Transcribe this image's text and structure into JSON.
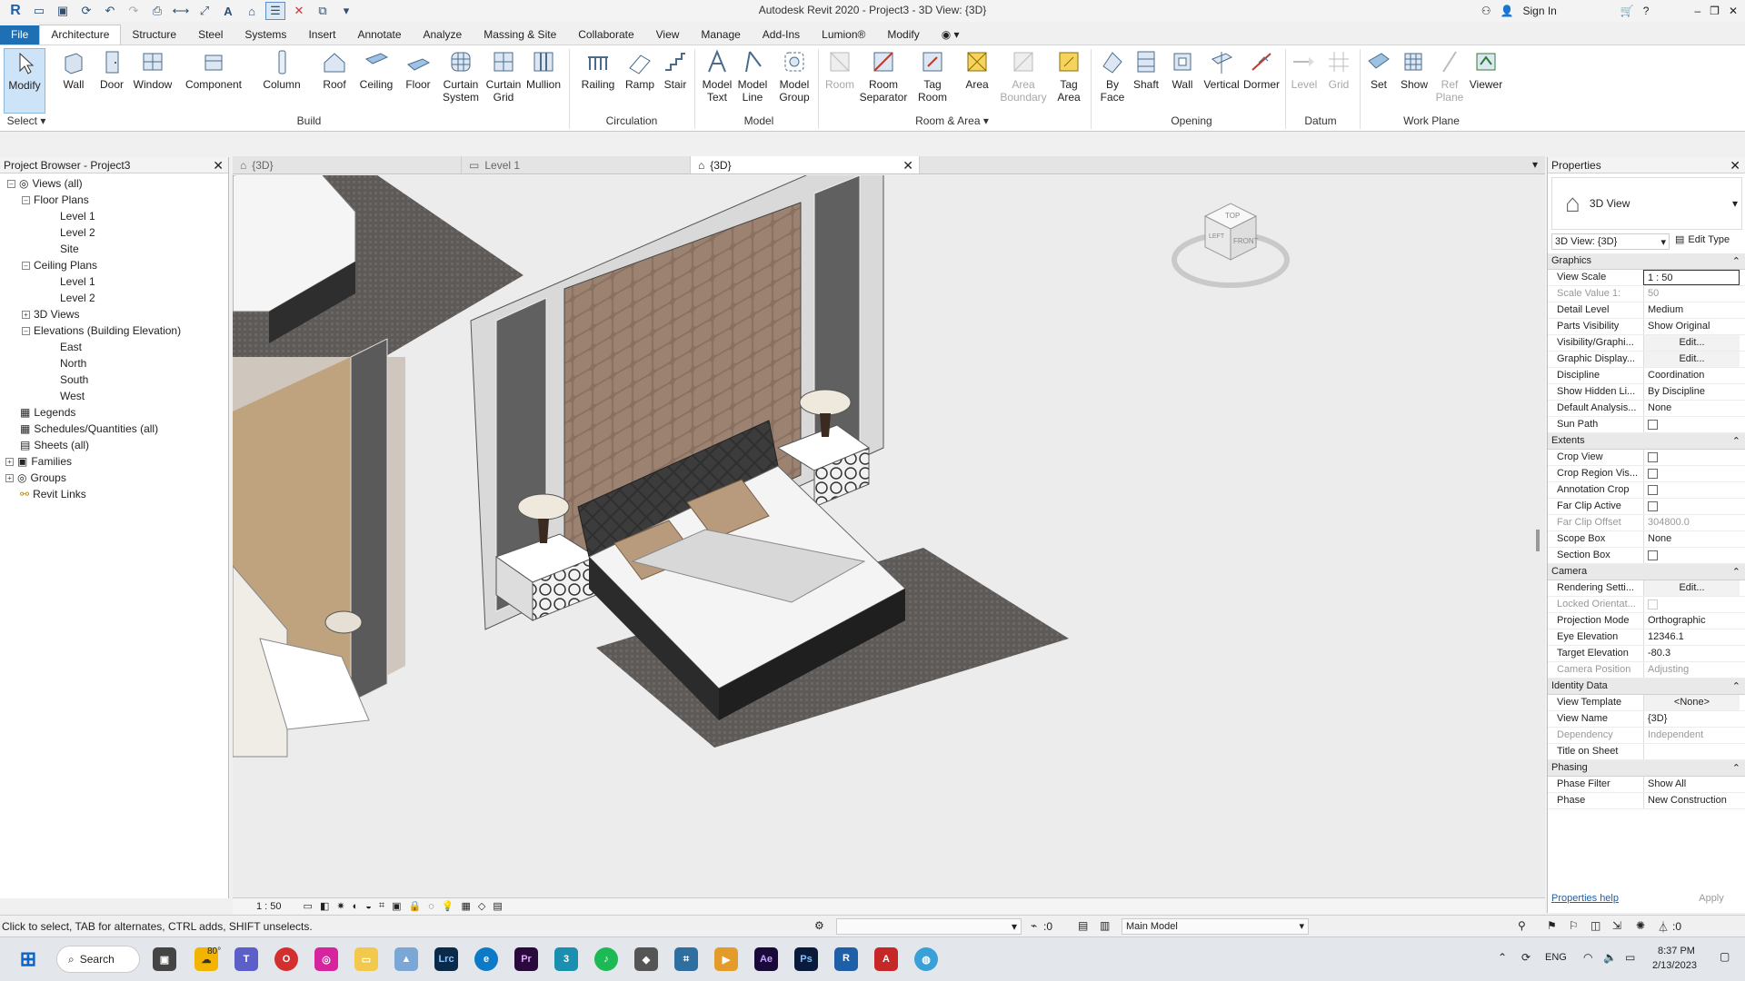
{
  "window": {
    "title": "Autodesk Revit 2020 - Project3 - 3D View: {3D}",
    "sign_in": "Sign In"
  },
  "ribbon_tabs": [
    "File",
    "Architecture",
    "Structure",
    "Steel",
    "Systems",
    "Insert",
    "Annotate",
    "Analyze",
    "Massing & Site",
    "Collaborate",
    "View",
    "Manage",
    "Add-Ins",
    "Lumion®",
    "Modify"
  ],
  "tools": {
    "modify": "Modify",
    "wall": "Wall",
    "door": "Door",
    "window": "Window",
    "component": "Component",
    "column": "Column",
    "roof": "Roof",
    "ceiling": "Ceiling",
    "floor": "Floor",
    "curtain_system_1": "Curtain",
    "curtain_system_2": "System",
    "curtain_grid_1": "Curtain",
    "curtain_grid_2": "Grid",
    "mullion": "Mullion",
    "railing": "Railing",
    "ramp": "Ramp",
    "stair": "Stair",
    "model_text_1": "Model",
    "model_text_2": "Text",
    "model_line_1": "Model",
    "model_line_2": "Line",
    "model_group_1": "Model",
    "model_group_2": "Group",
    "room": "Room",
    "room_sep_1": "Room",
    "room_sep_2": "Separator",
    "tag_room_1": "Tag",
    "tag_room_2": "Room",
    "area": "Area",
    "area_boundary_1": "Area",
    "area_boundary_2": "Boundary",
    "tag_area_1": "Tag",
    "tag_area_2": "Area",
    "by_face_1": "By",
    "by_face_2": "Face",
    "shaft": "Shaft",
    "wall_opening": "Wall",
    "vertical": "Vertical",
    "dormer": "Dormer",
    "level": "Level",
    "grid": "Grid",
    "set": "Set",
    "show": "Show",
    "ref_plane_1": "Ref",
    "ref_plane_2": "Plane",
    "viewer": "Viewer"
  },
  "groups": {
    "select": "Select ▾",
    "build": "Build",
    "circulation": "Circulation",
    "model": "Model",
    "room_area": "Room & Area ▾",
    "opening": "Opening",
    "datum": "Datum",
    "work_plane": "Work Plane"
  },
  "browser": {
    "title": "Project Browser - Project3",
    "items": [
      "Views (all)",
      "Floor Plans",
      "Level 1",
      "Level 2",
      "Site",
      "Ceiling Plans",
      "Level 1",
      "Level 2",
      "3D Views",
      "Elevations (Building Elevation)",
      "East",
      "North",
      "South",
      "West",
      "Legends",
      "Schedules/Quantities (all)",
      "Sheets (all)",
      "Families",
      "Groups",
      "Revit Links"
    ]
  },
  "view_tabs": [
    "{3D}",
    "Level 1",
    "{3D}"
  ],
  "viewcube": {
    "top": "TOP",
    "front": "FRONT",
    "left": "LEFT"
  },
  "view_scale_label": "1 : 50",
  "properties": {
    "title": "Properties",
    "type": "3D View",
    "selector": "3D View: {3D}",
    "edit_type": "Edit Type",
    "sections": {
      "graphics": "Graphics",
      "extents": "Extents",
      "camera": "Camera",
      "identity": "Identity Data",
      "phasing": "Phasing"
    },
    "rows": {
      "view_scale": [
        "View Scale",
        "1 : 50"
      ],
      "scale_value": [
        "Scale Value 1:",
        "50"
      ],
      "detail_level": [
        "Detail Level",
        "Medium"
      ],
      "parts_visibility": [
        "Parts Visibility",
        "Show Original"
      ],
      "visibility": [
        "Visibility/Graphi...",
        "Edit..."
      ],
      "graphic_display": [
        "Graphic Display...",
        "Edit..."
      ],
      "discipline": [
        "Discipline",
        "Coordination"
      ],
      "hidden_lines": [
        "Show Hidden Li...",
        "By Discipline"
      ],
      "default_analysis": [
        "Default Analysis...",
        "None"
      ],
      "sun_path": [
        "Sun Path",
        ""
      ],
      "crop_view": [
        "Crop View",
        ""
      ],
      "crop_region": [
        "Crop Region Vis...",
        ""
      ],
      "annotation_crop": [
        "Annotation Crop",
        ""
      ],
      "far_clip_active": [
        "Far Clip Active",
        ""
      ],
      "far_clip_offset": [
        "Far Clip Offset",
        "304800.0"
      ],
      "scope_box": [
        "Scope Box",
        "None"
      ],
      "section_box": [
        "Section Box",
        ""
      ],
      "rendering": [
        "Rendering Setti...",
        "Edit..."
      ],
      "locked": [
        "Locked Orientat...",
        ""
      ],
      "projection": [
        "Projection Mode",
        "Orthographic"
      ],
      "eye_elev": [
        "Eye Elevation",
        "12346.1"
      ],
      "target_elev": [
        "Target Elevation",
        "-80.3"
      ],
      "camera_pos": [
        "Camera Position",
        "Adjusting"
      ],
      "view_template": [
        "View Template",
        "<None>"
      ],
      "view_name": [
        "View Name",
        "{3D}"
      ],
      "dependency": [
        "Dependency",
        "Independent"
      ],
      "title_sheet": [
        "Title on Sheet",
        ""
      ],
      "phase_filter": [
        "Phase Filter",
        "Show All"
      ],
      "phase": [
        "Phase",
        "New Construction"
      ]
    },
    "help": "Properties help",
    "apply": "Apply"
  },
  "status": {
    "hint": "Click to select, TAB for alternates, CTRL adds, SHIFT unselects.",
    "zero": ":0",
    "model": "Main Model",
    "filter": ":0"
  },
  "taskbar": {
    "search": "Search",
    "temp": "80°",
    "lang": "ENG",
    "time": "8:37 PM",
    "date": "2/13/2023"
  }
}
